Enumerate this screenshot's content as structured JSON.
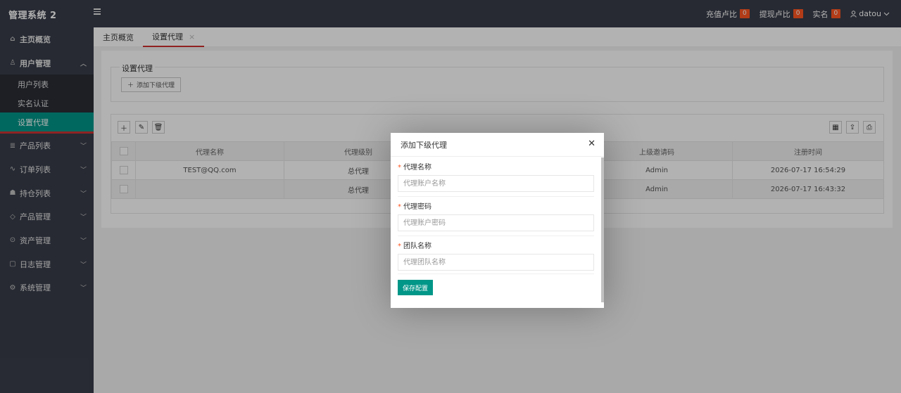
{
  "header": {
    "logo": "管理系统 2",
    "recharge_label": "充值卢比",
    "recharge_count": "0",
    "withdraw_label": "提现卢比",
    "withdraw_count": "0",
    "realname_label": "实名",
    "realname_count": "0",
    "username": "datou"
  },
  "sidebar": {
    "items": [
      {
        "label": "主页概览",
        "icon": "home-icon"
      },
      {
        "label": "用户管理",
        "icon": "user-icon",
        "expanded": true
      },
      {
        "label": "产品列表",
        "icon": "list-icon"
      },
      {
        "label": "订单列表",
        "icon": "pulse-icon"
      },
      {
        "label": "持仓列表",
        "icon": "group-icon"
      },
      {
        "label": "产品管理",
        "icon": "diamond-icon"
      },
      {
        "label": "资产管理",
        "icon": "rmb-icon"
      },
      {
        "label": "日志管理",
        "icon": "file-icon"
      },
      {
        "label": "系统管理",
        "icon": "gear-icon"
      }
    ],
    "sub_items": [
      {
        "label": "用户列表"
      },
      {
        "label": "实名认证"
      },
      {
        "label": "设置代理",
        "active": true
      }
    ]
  },
  "tabs": [
    {
      "label": "主页概览"
    },
    {
      "label": "设置代理",
      "active": true
    }
  ],
  "page": {
    "fieldset_legend": "设置代理",
    "add_sub_agent_label": "添加下级代理"
  },
  "table": {
    "columns": [
      "代理名称",
      "代理级别",
      "上级邀请码",
      "注册时间"
    ],
    "rows": [
      {
        "name": "TEST@QQ.com",
        "level": "总代理",
        "inviter": "Admin",
        "time": "2026-07-17 16:54:29"
      },
      {
        "name": "",
        "level": "总代理",
        "inviter": "Admin",
        "time": "2026-07-17 16:43:32"
      }
    ]
  },
  "modal": {
    "title": "添加下级代理",
    "fields": [
      {
        "label": "代理名称",
        "placeholder": "代理账户名称"
      },
      {
        "label": "代理密码",
        "placeholder": "代理账户密码"
      },
      {
        "label": "团队名称",
        "placeholder": "代理团队名称"
      }
    ],
    "required_mark": "*",
    "save_label": "保存配置"
  },
  "colors": {
    "accent": "#009688",
    "header_bg": "#393d49",
    "badge": "#ff5722",
    "tab_active_underline": "#d02f2f"
  }
}
